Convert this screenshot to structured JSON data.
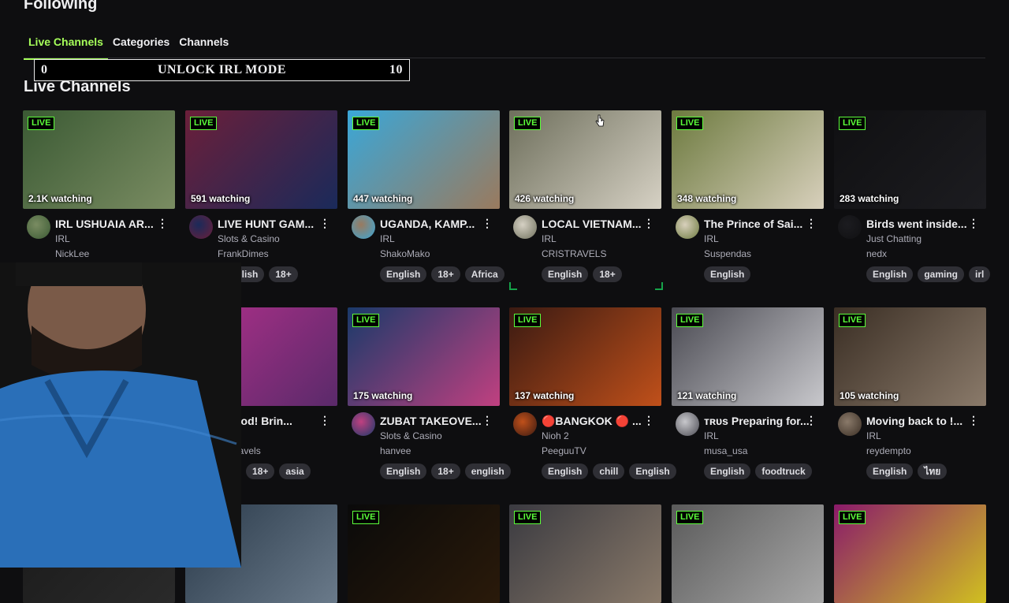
{
  "page": {
    "title": "Following",
    "section_title": "Live Channels"
  },
  "tabs": [
    {
      "label": "Live Channels",
      "active": true
    },
    {
      "label": "Categories",
      "active": false
    },
    {
      "label": "Channels",
      "active": false
    }
  ],
  "overlay": {
    "left_value": "0",
    "title": "UNLOCK IRL MODE",
    "right_value": "10"
  },
  "live_badge": "LIVE",
  "rows": [
    [
      {
        "watching": "2.1K watching",
        "title": "IRL USHUAIA AR...",
        "category": "IRL",
        "channel": "NickLee",
        "tags": [],
        "thumb": [
          "#3b5a34",
          "#7a8c62"
        ]
      },
      {
        "watching": "591 watching",
        "title": "LIVE HUNT GAM...",
        "category": "Slots & Casino",
        "channel": "FrankDimes",
        "tags": [
          "English",
          "18+"
        ],
        "thumb": [
          "#6b1f3a",
          "#1a2a5a"
        ]
      },
      {
        "watching": "447 watching",
        "title": "UGANDA, KAMP...",
        "category": "IRL",
        "channel": "ShakoMako",
        "tags": [
          "English",
          "18+",
          "Africa"
        ],
        "thumb": [
          "#3aa7d8",
          "#9a7a5e"
        ]
      },
      {
        "watching": "426 watching",
        "title": "LOCAL VIETNAM...",
        "category": "IRL",
        "channel": "CRISTRAVELS",
        "tags": [
          "English",
          "18+"
        ],
        "thumb": [
          "#6e6f5c",
          "#d6d1c4"
        ]
      },
      {
        "watching": "348 watching",
        "title": "The Prince of Sai...",
        "category": "IRL",
        "channel": "Suspendas",
        "tags": [
          "English"
        ],
        "thumb": [
          "#6d7a3f",
          "#d8d0bc"
        ]
      },
      {
        "watching": "283 watching",
        "title": "Birds went inside...",
        "category": "Just Chatting",
        "channel": "nedx",
        "tags": [
          "English",
          "gaming",
          "irl"
        ],
        "thumb": [
          "#101012",
          "#1c1c20"
        ]
      }
    ],
    [
      {
        "watching": "",
        "title": "",
        "category": "",
        "channel": "",
        "tags": [],
        "thumb": [
          "#2a2a2a",
          "#3a3a3a"
        ]
      },
      {
        "watching": "...g",
        "title": "n good! Brin...",
        "category": "",
        "channel": "ns_travels",
        "tags": [
          "sh",
          "18+",
          "asia"
        ],
        "thumb": [
          "#b0308a",
          "#5a2a6a"
        ]
      },
      {
        "watching": "175 watching",
        "title": "ZUBAT TAKEOVE...",
        "category": "Slots & Casino",
        "channel": "hanvee",
        "tags": [
          "English",
          "18+",
          "english"
        ],
        "thumb": [
          "#1a3a6a",
          "#c04080"
        ]
      },
      {
        "watching": "137 watching",
        "title": "🔴BANGKOK 🔴 ...",
        "category": "Nioh 2",
        "channel": "PeeguuTV",
        "tags": [
          "English",
          "chill",
          "English"
        ],
        "thumb": [
          "#3a1a12",
          "#c0501a"
        ]
      },
      {
        "watching": "121 watching",
        "title": "ᴛʀᴜs Preparing for...",
        "category": "IRL",
        "channel": "musa_usa",
        "tags": [
          "English",
          "foodtruck"
        ],
        "thumb": [
          "#4a4a52",
          "#c8c8cc"
        ]
      },
      {
        "watching": "105 watching",
        "title": "Moving back to !...",
        "category": "IRL",
        "channel": "reydempto",
        "tags": [
          "English",
          "ไทย"
        ],
        "thumb": [
          "#3a2e24",
          "#8a7a6a"
        ]
      }
    ],
    [
      {
        "watching": "",
        "title": "",
        "category": "",
        "channel": "",
        "tags": [],
        "thumb": [
          "#1a1a1a",
          "#2a2a2a"
        ]
      },
      {
        "watching": "",
        "title": "",
        "category": "",
        "channel": "",
        "tags": [],
        "thumb": [
          "#2a3a4a",
          "#6a7a8a"
        ]
      },
      {
        "watching": "",
        "title": "",
        "category": "",
        "channel": "",
        "tags": [],
        "thumb": [
          "#0a0a0a",
          "#2a1a0a"
        ]
      },
      {
        "watching": "",
        "title": "",
        "category": "",
        "channel": "",
        "tags": [],
        "thumb": [
          "#3a3a40",
          "#8a7a6a"
        ]
      },
      {
        "watching": "",
        "title": "",
        "category": "",
        "channel": "",
        "tags": [],
        "thumb": [
          "#5a5a5a",
          "#a8a8a8"
        ]
      },
      {
        "watching": "",
        "title": "",
        "category": "",
        "channel": "",
        "tags": [],
        "thumb": [
          "#8a1a6a",
          "#d0c020"
        ]
      }
    ]
  ],
  "colors": {
    "accent": "#a6ff5a",
    "live_green": "#5cff3a",
    "background": "#0e0e10",
    "tag_bg": "#2f2f35"
  }
}
